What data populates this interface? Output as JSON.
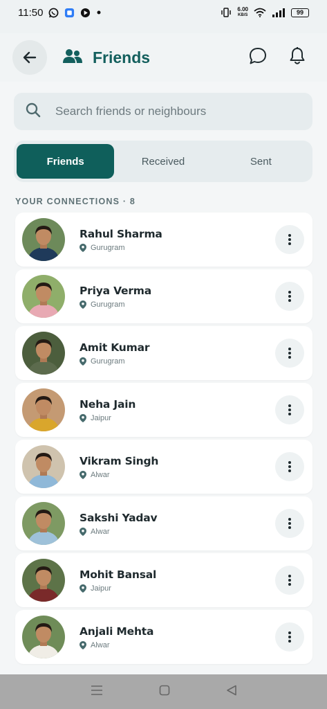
{
  "status_bar": {
    "time": "11:50",
    "net_speed_value": "6.00",
    "net_speed_unit": "KB/S",
    "battery": "99"
  },
  "header": {
    "title": "Friends"
  },
  "search": {
    "placeholder": "Search friends or neighbours"
  },
  "tabs": [
    {
      "label": "Friends",
      "active": true
    },
    {
      "label": "Received",
      "active": false
    },
    {
      "label": "Sent",
      "active": false
    }
  ],
  "section_label": "YOUR CONNECTIONS · 8",
  "friends": [
    {
      "name": "Rahul Sharma",
      "location": "Gurugram",
      "bg": "#6d8a5a",
      "shirt": "#1f3a5a"
    },
    {
      "name": "Priya Verma",
      "location": "Gurugram",
      "bg": "#8fae6a",
      "shirt": "#e8a9b3"
    },
    {
      "name": "Amit Kumar",
      "location": "Gurugram",
      "bg": "#4c5e3d",
      "shirt": "#5c6b4d"
    },
    {
      "name": "Neha Jain",
      "location": "Jaipur",
      "bg": "#c49a73",
      "shirt": "#d9a62c"
    },
    {
      "name": "Vikram Singh",
      "location": "Alwar",
      "bg": "#cfc3ae",
      "shirt": "#8fb8d8"
    },
    {
      "name": "Sakshi Yadav",
      "location": "Alwar",
      "bg": "#7e9a63",
      "shirt": "#9ec1d9"
    },
    {
      "name": "Mohit Bansal",
      "location": "Jaipur",
      "bg": "#5d7348",
      "shirt": "#7a2a2a"
    },
    {
      "name": "Anjali Mehta",
      "location": "Alwar",
      "bg": "#6f8c58",
      "shirt": "#f0ede6"
    }
  ],
  "colors": {
    "accent": "#0f5f5b",
    "title": "#135f5d"
  }
}
